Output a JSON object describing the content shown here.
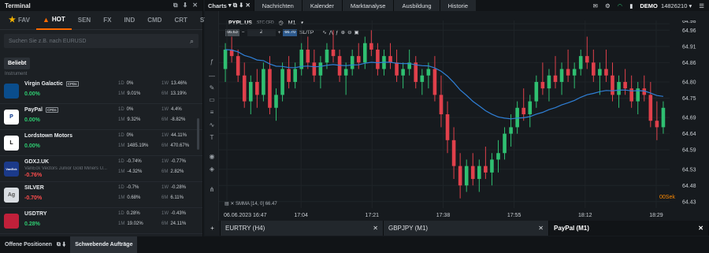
{
  "left_panel": {
    "title": "Terminal",
    "controls": [
      "⧉",
      "⬇",
      "✕"
    ],
    "tabs": [
      {
        "label": "FAV",
        "icon": "star-icon",
        "active": false
      },
      {
        "label": "HOT",
        "icon": "flame-icon",
        "active": true
      },
      {
        "label": "SEN",
        "active": false
      },
      {
        "label": "FX",
        "active": false
      },
      {
        "label": "IND",
        "active": false
      },
      {
        "label": "CMD",
        "active": false
      },
      {
        "label": "CRT",
        "active": false
      },
      {
        "label": "STC",
        "active": false
      }
    ],
    "search_placeholder": "Suchen Sie z.B. nach EURUSD",
    "chip": "Beliebt",
    "instrument_label": "Instrument",
    "rows": [
      {
        "name": "Virgin Galactic",
        "badge": "CFDs",
        "sub": "",
        "pct": "0.00%",
        "dir": "pos",
        "logo_text": "",
        "logo_bg": "#0a4d8c",
        "logo_fg": "#ffffff",
        "stats": [
          {
            "k": "1D",
            "v": "0%"
          },
          {
            "k": "1W",
            "v": "13.46%"
          },
          {
            "k": "1M",
            "v": "9.01%"
          },
          {
            "k": "6M",
            "v": "13.19%"
          }
        ]
      },
      {
        "name": "PayPal",
        "badge": "CFDs",
        "sub": "",
        "pct": "0.00%",
        "dir": "pos",
        "logo_text": "P",
        "logo_bg": "#ffffff",
        "logo_fg": "#003087",
        "stats": [
          {
            "k": "1D",
            "v": "0%"
          },
          {
            "k": "1W",
            "v": "4.4%"
          },
          {
            "k": "1M",
            "v": "9.32%"
          },
          {
            "k": "6M",
            "v": "-8.82%"
          }
        ]
      },
      {
        "name": "Lordstown Motors",
        "badge": "",
        "sub": "",
        "pct": "0.00%",
        "dir": "pos",
        "logo_text": "L",
        "logo_bg": "#ffffff",
        "logo_fg": "#111111",
        "stats": [
          {
            "k": "1D",
            "v": "0%"
          },
          {
            "k": "1W",
            "v": "44.11%"
          },
          {
            "k": "1M",
            "v": "1485.19%"
          },
          {
            "k": "6M",
            "v": "470.67%"
          }
        ]
      },
      {
        "name": "GDXJ.UK",
        "badge": "",
        "sub": "VanEck Vectors Junior Gold Miners U...",
        "pct": "-0.76%",
        "dir": "neg",
        "logo_text": "VanEck",
        "logo_bg": "#1b3a8a",
        "logo_fg": "#ffffff",
        "stats": [
          {
            "k": "1D",
            "v": "-0.74%"
          },
          {
            "k": "1W",
            "v": "-0.77%"
          },
          {
            "k": "1M",
            "v": "-4.32%"
          },
          {
            "k": "6M",
            "v": "2.82%"
          }
        ]
      },
      {
        "name": "SILVER",
        "badge": "",
        "sub": "",
        "pct": "-0.70%",
        "dir": "neg",
        "logo_text": "Ag",
        "logo_bg": "#d9dde2",
        "logo_fg": "#555555",
        "stats": [
          {
            "k": "1D",
            "v": "-0.7%"
          },
          {
            "k": "1W",
            "v": "-0.28%"
          },
          {
            "k": "1M",
            "v": "0.68%"
          },
          {
            "k": "6M",
            "v": "6.11%"
          }
        ]
      },
      {
        "name": "USDTRY",
        "badge": "",
        "sub": "",
        "pct": "0.28%",
        "dir": "pos",
        "logo_text": "",
        "logo_bg": "#c0203a",
        "logo_fg": "#ffffff",
        "stats": [
          {
            "k": "1D",
            "v": "0.28%"
          },
          {
            "k": "1W",
            "v": "-0.43%"
          },
          {
            "k": "1M",
            "v": "19.02%"
          },
          {
            "k": "6M",
            "v": "24.11%"
          }
        ]
      }
    ]
  },
  "bottom_tabs": [
    {
      "label": "Offene Positionen",
      "selected": false
    },
    {
      "label": "Schwebende Aufträge",
      "selected": true
    }
  ],
  "top_nav": {
    "charts_label": "Charts",
    "items": [
      "Nachrichten",
      "Kalender",
      "Marktanalyse",
      "Ausbildung",
      "Historie"
    ],
    "demo_label": "DEMO",
    "account": "14826210"
  },
  "chart_header": {
    "symbol": "PYPL.US",
    "type_badge": "STC CFD",
    "timeframe": "M1",
    "sell_price": "66.63",
    "buy_price": "66.70",
    "qty": "2",
    "sltp": "SL/TP"
  },
  "chart_data": {
    "type": "candlestick",
    "title": "",
    "x_ticks": [
      "06.06.2023 16:47",
      "17:04",
      "17:21",
      "17:38",
      "17:55",
      "18:12",
      "18:29"
    ],
    "y_ticks": [
      "64.98",
      "64.96",
      "64.91",
      "64.86",
      "64.80",
      "64.75",
      "64.69",
      "64.64",
      "64.59",
      "64.53",
      "64.48",
      "64.43"
    ],
    "ylim": [
      64.41,
      64.99
    ],
    "indicator": "SMMA [14, 0] 66.47",
    "colors": {
      "up": "#2fbf71",
      "down": "#e0404b",
      "ma": "#2f7fd6"
    },
    "ohlc": [
      [
        64.84,
        64.92,
        64.8,
        64.9
      ],
      [
        64.9,
        64.94,
        64.86,
        64.88
      ],
      [
        64.88,
        64.9,
        64.8,
        64.82
      ],
      [
        64.82,
        64.86,
        64.72,
        64.74
      ],
      [
        64.74,
        64.82,
        64.7,
        64.8
      ],
      [
        64.8,
        64.84,
        64.72,
        64.76
      ],
      [
        64.76,
        64.86,
        64.74,
        64.84
      ],
      [
        64.84,
        64.88,
        64.7,
        64.72
      ],
      [
        64.72,
        64.78,
        64.68,
        64.76
      ],
      [
        64.76,
        64.86,
        64.74,
        64.84
      ],
      [
        64.84,
        64.88,
        64.78,
        64.8
      ],
      [
        64.8,
        64.86,
        64.78,
        64.84
      ],
      [
        64.84,
        64.92,
        64.82,
        64.9
      ],
      [
        64.9,
        64.94,
        64.84,
        64.86
      ],
      [
        64.86,
        64.9,
        64.8,
        64.82
      ],
      [
        64.82,
        64.88,
        64.78,
        64.86
      ],
      [
        64.86,
        64.92,
        64.84,
        64.9
      ],
      [
        64.9,
        64.96,
        64.86,
        64.88
      ],
      [
        64.88,
        64.9,
        64.8,
        64.82
      ],
      [
        64.82,
        64.86,
        64.76,
        64.84
      ],
      [
        64.84,
        64.9,
        64.82,
        64.88
      ],
      [
        64.88,
        64.92,
        64.84,
        64.86
      ],
      [
        64.86,
        64.94,
        64.84,
        64.92
      ],
      [
        64.92,
        64.96,
        64.88,
        64.9
      ],
      [
        64.9,
        64.92,
        64.82,
        64.84
      ],
      [
        64.84,
        64.9,
        64.82,
        64.88
      ],
      [
        64.88,
        64.92,
        64.84,
        64.86
      ],
      [
        64.86,
        64.9,
        64.8,
        64.82
      ],
      [
        64.82,
        64.86,
        64.78,
        64.84
      ],
      [
        64.84,
        64.9,
        64.82,
        64.86
      ],
      [
        64.86,
        64.88,
        64.78,
        64.8
      ],
      [
        64.8,
        64.84,
        64.76,
        64.82
      ],
      [
        64.82,
        64.86,
        64.78,
        64.84
      ],
      [
        64.84,
        64.88,
        64.74,
        64.76
      ],
      [
        64.76,
        64.82,
        64.66,
        64.7
      ],
      [
        64.7,
        64.74,
        64.58,
        64.62
      ],
      [
        64.62,
        64.66,
        64.5,
        64.54
      ],
      [
        64.54,
        64.58,
        64.44,
        64.48
      ],
      [
        64.48,
        64.56,
        64.46,
        64.54
      ],
      [
        64.54,
        64.58,
        64.48,
        64.5
      ],
      [
        64.5,
        64.56,
        64.46,
        64.54
      ],
      [
        64.54,
        64.6,
        64.5,
        64.52
      ],
      [
        64.52,
        64.58,
        64.48,
        64.56
      ],
      [
        64.56,
        64.62,
        64.52,
        64.58
      ],
      [
        64.58,
        64.66,
        64.56,
        64.64
      ],
      [
        64.64,
        64.7,
        64.6,
        64.66
      ],
      [
        64.66,
        64.74,
        64.64,
        64.72
      ],
      [
        64.72,
        64.78,
        64.68,
        64.7
      ],
      [
        64.7,
        64.76,
        64.66,
        64.74
      ],
      [
        64.74,
        64.82,
        64.72,
        64.8
      ],
      [
        64.8,
        64.86,
        64.76,
        64.78
      ],
      [
        64.78,
        64.84,
        64.74,
        64.82
      ],
      [
        64.82,
        64.88,
        64.78,
        64.8
      ],
      [
        64.8,
        64.86,
        64.76,
        64.84
      ],
      [
        64.84,
        64.9,
        64.8,
        64.82
      ],
      [
        64.82,
        64.86,
        64.78,
        64.84
      ],
      [
        64.84,
        64.9,
        64.82,
        64.88
      ],
      [
        64.88,
        64.94,
        64.84,
        64.86
      ],
      [
        64.86,
        64.9,
        64.8,
        64.82
      ],
      [
        64.82,
        64.86,
        64.76,
        64.84
      ],
      [
        64.84,
        64.9,
        64.8,
        64.82
      ],
      [
        64.82,
        64.86,
        64.74,
        64.76
      ],
      [
        64.76,
        64.82,
        64.72,
        64.8
      ],
      [
        64.8,
        64.84,
        64.76,
        64.78
      ],
      [
        64.78,
        64.82,
        64.72,
        64.74
      ],
      [
        64.74,
        64.8,
        64.7,
        64.78
      ],
      [
        64.78,
        64.82,
        64.74,
        64.76
      ],
      [
        64.76,
        64.8,
        64.66,
        64.68
      ],
      [
        64.68,
        64.74,
        64.62,
        64.66
      ],
      [
        64.66,
        64.74,
        64.64,
        64.72
      ]
    ]
  },
  "indicator_label": "SMMA [14, 0] 66.47",
  "timer": "00Sek",
  "chart_tabs": [
    {
      "label": "EURTRY (H4)",
      "active": false
    },
    {
      "label": "GBPJPY (M1)",
      "active": false
    },
    {
      "label": "PayPal (M1)",
      "active": true
    }
  ]
}
